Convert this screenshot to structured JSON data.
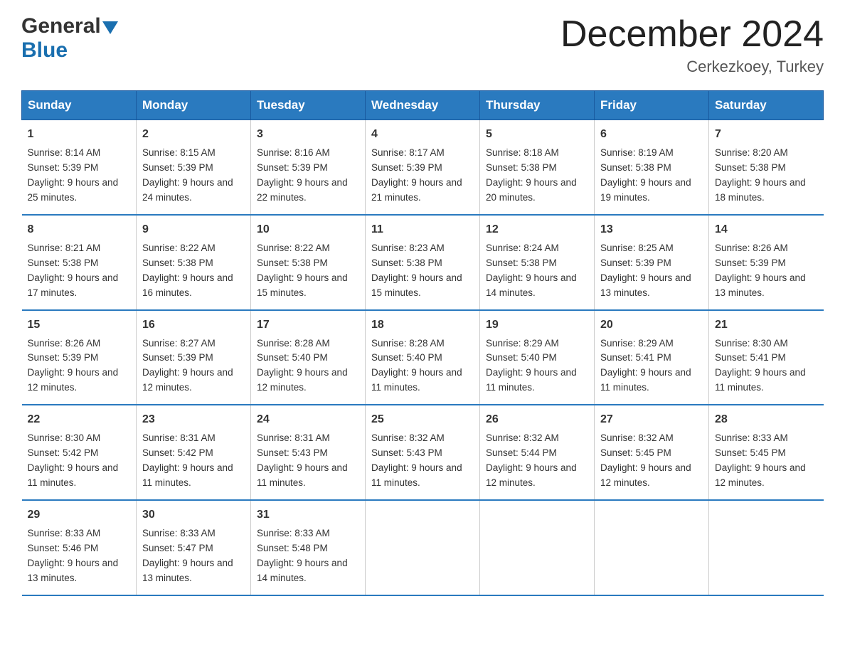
{
  "header": {
    "logo_general": "General",
    "logo_blue": "Blue",
    "month_title": "December 2024",
    "location": "Cerkezkoey, Turkey"
  },
  "weekdays": [
    "Sunday",
    "Monday",
    "Tuesday",
    "Wednesday",
    "Thursday",
    "Friday",
    "Saturday"
  ],
  "weeks": [
    [
      {
        "day": "1",
        "sunrise": "8:14 AM",
        "sunset": "5:39 PM",
        "daylight": "9 hours and 25 minutes."
      },
      {
        "day": "2",
        "sunrise": "8:15 AM",
        "sunset": "5:39 PM",
        "daylight": "9 hours and 24 minutes."
      },
      {
        "day": "3",
        "sunrise": "8:16 AM",
        "sunset": "5:39 PM",
        "daylight": "9 hours and 22 minutes."
      },
      {
        "day": "4",
        "sunrise": "8:17 AM",
        "sunset": "5:39 PM",
        "daylight": "9 hours and 21 minutes."
      },
      {
        "day": "5",
        "sunrise": "8:18 AM",
        "sunset": "5:38 PM",
        "daylight": "9 hours and 20 minutes."
      },
      {
        "day": "6",
        "sunrise": "8:19 AM",
        "sunset": "5:38 PM",
        "daylight": "9 hours and 19 minutes."
      },
      {
        "day": "7",
        "sunrise": "8:20 AM",
        "sunset": "5:38 PM",
        "daylight": "9 hours and 18 minutes."
      }
    ],
    [
      {
        "day": "8",
        "sunrise": "8:21 AM",
        "sunset": "5:38 PM",
        "daylight": "9 hours and 17 minutes."
      },
      {
        "day": "9",
        "sunrise": "8:22 AM",
        "sunset": "5:38 PM",
        "daylight": "9 hours and 16 minutes."
      },
      {
        "day": "10",
        "sunrise": "8:22 AM",
        "sunset": "5:38 PM",
        "daylight": "9 hours and 15 minutes."
      },
      {
        "day": "11",
        "sunrise": "8:23 AM",
        "sunset": "5:38 PM",
        "daylight": "9 hours and 15 minutes."
      },
      {
        "day": "12",
        "sunrise": "8:24 AM",
        "sunset": "5:38 PM",
        "daylight": "9 hours and 14 minutes."
      },
      {
        "day": "13",
        "sunrise": "8:25 AM",
        "sunset": "5:39 PM",
        "daylight": "9 hours and 13 minutes."
      },
      {
        "day": "14",
        "sunrise": "8:26 AM",
        "sunset": "5:39 PM",
        "daylight": "9 hours and 13 minutes."
      }
    ],
    [
      {
        "day": "15",
        "sunrise": "8:26 AM",
        "sunset": "5:39 PM",
        "daylight": "9 hours and 12 minutes."
      },
      {
        "day": "16",
        "sunrise": "8:27 AM",
        "sunset": "5:39 PM",
        "daylight": "9 hours and 12 minutes."
      },
      {
        "day": "17",
        "sunrise": "8:28 AM",
        "sunset": "5:40 PM",
        "daylight": "9 hours and 12 minutes."
      },
      {
        "day": "18",
        "sunrise": "8:28 AM",
        "sunset": "5:40 PM",
        "daylight": "9 hours and 11 minutes."
      },
      {
        "day": "19",
        "sunrise": "8:29 AM",
        "sunset": "5:40 PM",
        "daylight": "9 hours and 11 minutes."
      },
      {
        "day": "20",
        "sunrise": "8:29 AM",
        "sunset": "5:41 PM",
        "daylight": "9 hours and 11 minutes."
      },
      {
        "day": "21",
        "sunrise": "8:30 AM",
        "sunset": "5:41 PM",
        "daylight": "9 hours and 11 minutes."
      }
    ],
    [
      {
        "day": "22",
        "sunrise": "8:30 AM",
        "sunset": "5:42 PM",
        "daylight": "9 hours and 11 minutes."
      },
      {
        "day": "23",
        "sunrise": "8:31 AM",
        "sunset": "5:42 PM",
        "daylight": "9 hours and 11 minutes."
      },
      {
        "day": "24",
        "sunrise": "8:31 AM",
        "sunset": "5:43 PM",
        "daylight": "9 hours and 11 minutes."
      },
      {
        "day": "25",
        "sunrise": "8:32 AM",
        "sunset": "5:43 PM",
        "daylight": "9 hours and 11 minutes."
      },
      {
        "day": "26",
        "sunrise": "8:32 AM",
        "sunset": "5:44 PM",
        "daylight": "9 hours and 12 minutes."
      },
      {
        "day": "27",
        "sunrise": "8:32 AM",
        "sunset": "5:45 PM",
        "daylight": "9 hours and 12 minutes."
      },
      {
        "day": "28",
        "sunrise": "8:33 AM",
        "sunset": "5:45 PM",
        "daylight": "9 hours and 12 minutes."
      }
    ],
    [
      {
        "day": "29",
        "sunrise": "8:33 AM",
        "sunset": "5:46 PM",
        "daylight": "9 hours and 13 minutes."
      },
      {
        "day": "30",
        "sunrise": "8:33 AM",
        "sunset": "5:47 PM",
        "daylight": "9 hours and 13 minutes."
      },
      {
        "day": "31",
        "sunrise": "8:33 AM",
        "sunset": "5:48 PM",
        "daylight": "9 hours and 14 minutes."
      },
      null,
      null,
      null,
      null
    ]
  ]
}
